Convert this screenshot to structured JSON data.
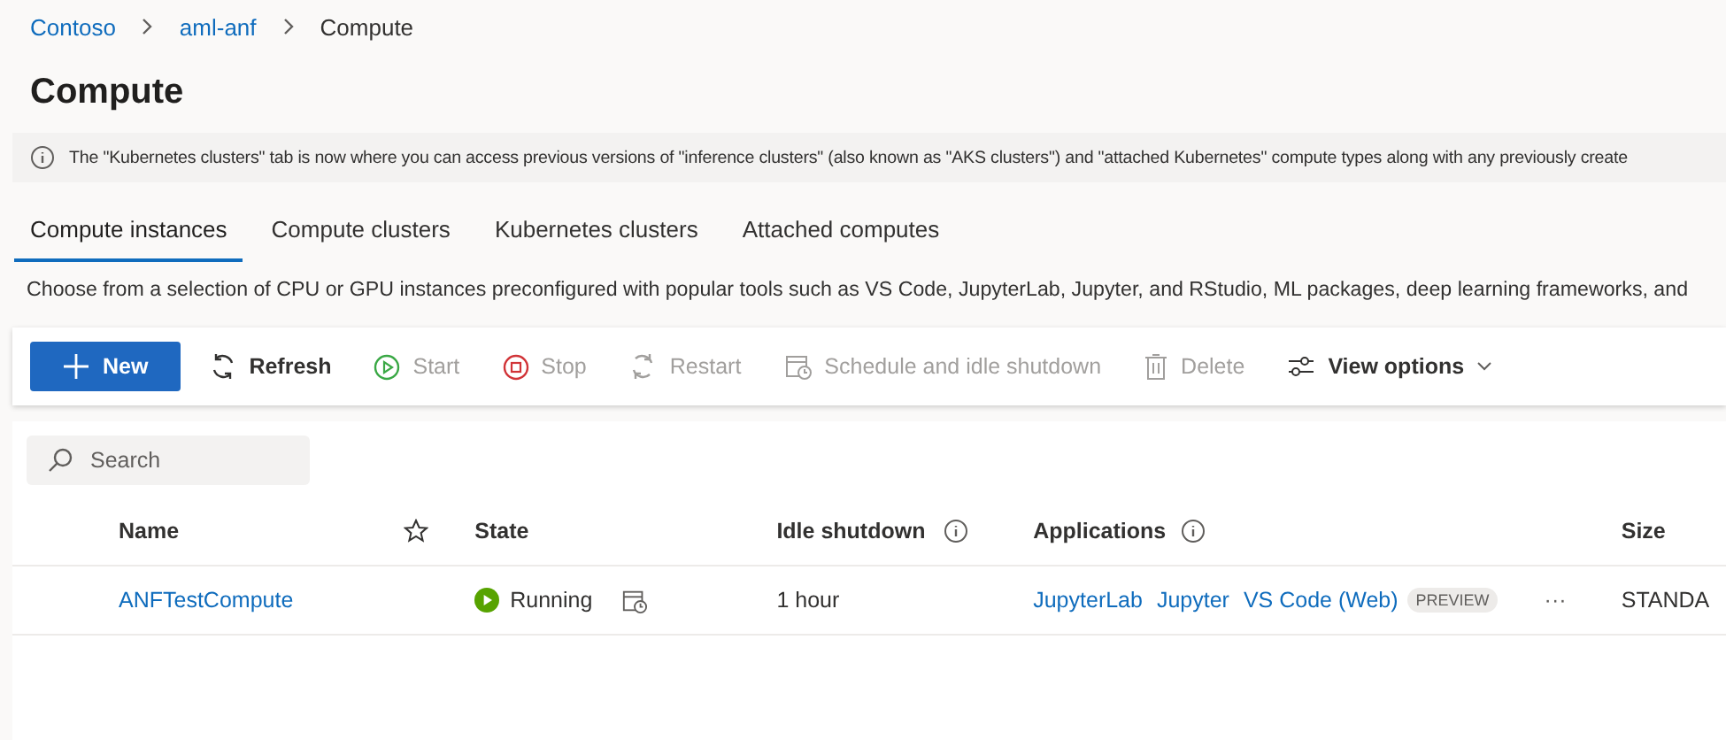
{
  "breadcrumb": [
    {
      "label": "Contoso",
      "link": true
    },
    {
      "label": "aml-anf",
      "link": true
    },
    {
      "label": "Compute",
      "link": false
    }
  ],
  "title": "Compute",
  "info_banner": "The \"Kubernetes clusters\" tab is now where you can access previous versions of \"inference clusters\" (also known as \"AKS clusters\") and \"attached Kubernetes\" compute types along with any previously create",
  "tabs": [
    {
      "label": "Compute instances",
      "selected": true
    },
    {
      "label": "Compute clusters",
      "selected": false
    },
    {
      "label": "Kubernetes clusters",
      "selected": false
    },
    {
      "label": "Attached computes",
      "selected": false
    }
  ],
  "description": "Choose from a selection of CPU or GPU instances preconfigured with popular tools such as VS Code, JupyterLab, Jupyter, and RStudio, ML packages, deep learning frameworks, and",
  "toolbar": [
    {
      "kind": "new",
      "label": "New",
      "disabled": false
    },
    {
      "kind": "refresh",
      "label": "Refresh",
      "disabled": false
    },
    {
      "kind": "start",
      "label": "Start",
      "disabled": true
    },
    {
      "kind": "stop",
      "label": "Stop",
      "disabled": true
    },
    {
      "kind": "restart",
      "label": "Restart",
      "disabled": true
    },
    {
      "kind": "schedule",
      "label": "Schedule and idle shutdown",
      "disabled": true
    },
    {
      "kind": "delete",
      "label": "Delete",
      "disabled": true
    },
    {
      "kind": "view",
      "label": "View options",
      "disabled": false
    }
  ],
  "search": {
    "placeholder": "Search"
  },
  "table": {
    "columns": [
      {
        "kind": "text",
        "label": "Name"
      },
      {
        "kind": "star"
      },
      {
        "kind": "text",
        "label": "State"
      },
      {
        "kind": "info",
        "label": "Idle shutdown"
      },
      {
        "kind": "info",
        "label": "Applications"
      },
      {
        "kind": "text",
        "label": "Size"
      }
    ],
    "rows": [
      {
        "name": "ANFTestCompute",
        "state": "Running",
        "idle_shutdown": "1 hour",
        "applications": [
          {
            "label": "JupyterLab"
          },
          {
            "label": "Jupyter"
          },
          {
            "label": "VS Code (Web)",
            "badge": "PREVIEW"
          }
        ],
        "more": "···",
        "size": "STANDA"
      }
    ]
  }
}
